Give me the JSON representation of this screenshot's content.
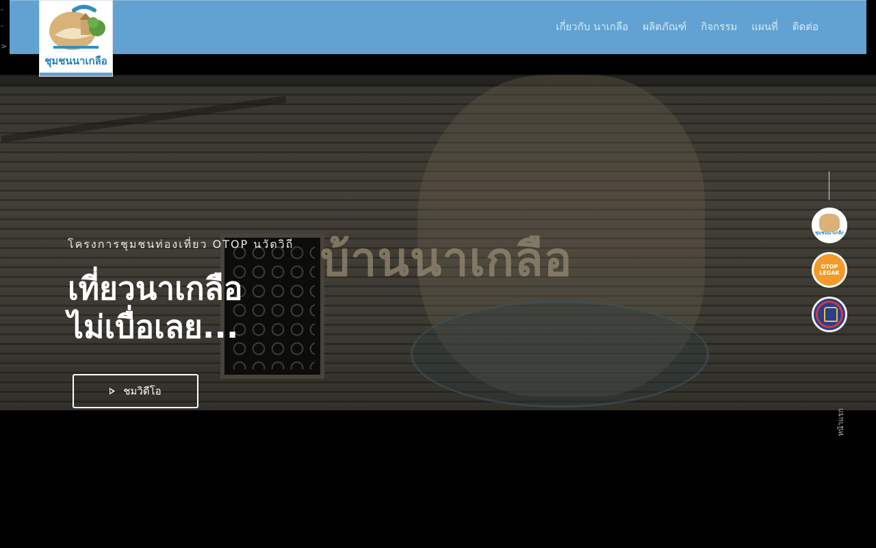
{
  "brand": {
    "logo_text": "ชุมชนนาเกลือ"
  },
  "nav": {
    "items": [
      {
        "label": "เกี่ยวกับ นาเกลือ"
      },
      {
        "label": "ผลิตภัณฑ์"
      },
      {
        "label": "กิจกรรม"
      },
      {
        "label": "แผนที่"
      },
      {
        "label": "ติดต่อ"
      }
    ]
  },
  "hero": {
    "subtitle": "โครงการชุมชนท่องเที่ยว OTOP นวัตวิถี",
    "title_line1": "เที่ยวนาเกลือ",
    "title_line2": "ไม่เบื่อเลย...",
    "mural_text": "บ้านนาเกลือ",
    "video_button_label": "ชมวิดีโอ"
  },
  "side_badges": {
    "community_text": "ชุมชนนาเกลือ",
    "otop_text": "OTOP LEGAK",
    "scroll_label": "หน้าแรก"
  },
  "colors": {
    "header_bg": "#62a2d2",
    "page_bg": "#000000",
    "otop_orange": "#f39a28"
  }
}
